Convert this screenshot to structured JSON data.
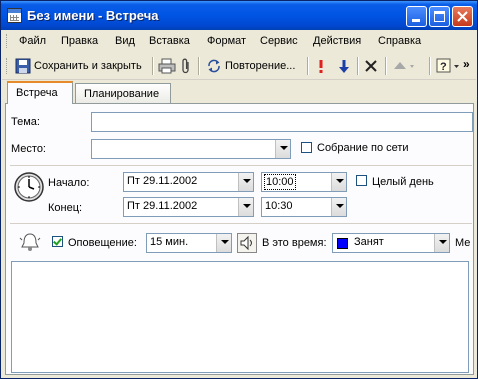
{
  "window": {
    "title": "Без имени - Встреча"
  },
  "menu": [
    {
      "label": "Файл"
    },
    {
      "label": "Правка"
    },
    {
      "label": "Вид"
    },
    {
      "label": "Вставка"
    },
    {
      "label": "Формат"
    },
    {
      "label": "Сервис"
    },
    {
      "label": "Действия"
    },
    {
      "label": "Справка"
    }
  ],
  "toolbar": {
    "save_close": "Сохранить и закрыть",
    "recurrence": "Повторение...",
    "more": "»"
  },
  "tabs": [
    {
      "label": "Встреча"
    },
    {
      "label": "Планирование"
    }
  ],
  "form": {
    "subject_label": "Тема:",
    "subject_value": "",
    "location_label": "Место:",
    "location_value": "",
    "online_meeting_label": "Собрание по сети",
    "start_label": "Начало:",
    "start_date": "Пт 29.11.2002",
    "start_time": "10:00",
    "allday_label": "Целый день",
    "end_label": "Конец:",
    "end_date": "Пт 29.11.2002",
    "end_time": "10:30",
    "reminder_label": "Оповещение:",
    "reminder_value": "15 мин.",
    "showas_label": "В это время:",
    "showas_value": "Занят",
    "label_cut": "Ме"
  },
  "colors": {
    "busy": "#0000ff",
    "titlebar": "#0054e3",
    "accent_tab": "#e68b2c"
  }
}
